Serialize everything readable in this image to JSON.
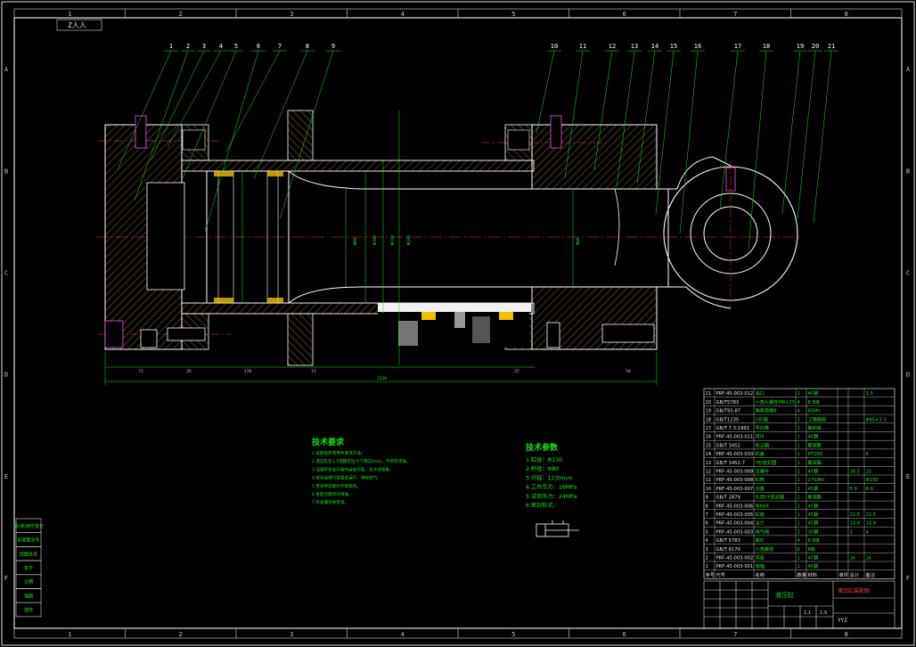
{
  "sheet": {
    "corner_code": "Z人人",
    "title_code": "YYZ",
    "drawing_name": "液压缸",
    "company_name": "液压缸装配图",
    "scale_row": [
      "",
      "",
      "1:1",
      "1:5"
    ]
  },
  "zones": {
    "columns": [
      "1",
      "2",
      "3",
      "4",
      "5",
      "6",
      "7",
      "8"
    ],
    "rows": [
      "A",
      "B",
      "C",
      "D",
      "E",
      "F"
    ]
  },
  "balloons": [
    "1",
    "2",
    "3",
    "4",
    "5",
    "6",
    "7",
    "8",
    "9",
    "10",
    "11",
    "12",
    "13",
    "14",
    "15",
    "16",
    "17",
    "18",
    "19",
    "20",
    "21"
  ],
  "dimensions": {
    "overall_length": "1230",
    "segments": [
      "72",
      "25",
      "178",
      "15",
      "37",
      "58"
    ],
    "bore_dims": [
      "Φ80",
      "Φ100",
      "Φ110",
      "Φ130"
    ],
    "rod_dim": "Φ60"
  },
  "technical_requirements": {
    "title": "技术要求",
    "lines": [
      "1.装配前所有零件清洗干净。",
      "2.液压缸在1.5倍额定压力下保压5min，不得有渗漏。",
      "3.活塞杆在全行程内运动平稳，无卡滞现象。",
      "4.安装后进行空载试运行，排除空气。",
      "5.密封件装配时不得损伤。",
      "6.各配合面涂润滑油。",
      "7.外表面涂防锈漆。"
    ]
  },
  "technical_parameters": {
    "title": "技术参数",
    "lines": [
      "1.缸径：Φ130",
      "2.杆径：Φ80",
      "3.行程：1230mm",
      "4.工作压力：16MPa",
      "5.试验压力：24MPa",
      "6.密封形式："
    ]
  },
  "parts_list": {
    "headers": [
      "序号",
      "代号",
      "名称",
      "数量",
      "材料",
      "单件",
      "总计",
      "备注"
    ],
    "rows": [
      [
        "21",
        "PRF-45-003-012",
        "油口",
        "1",
        "45钢",
        "",
        "",
        "1.5"
      ],
      [
        "20",
        "GB/T5783",
        "六角头螺栓M8×25",
        "4",
        "8.8级",
        "",
        "",
        ""
      ],
      [
        "19",
        "GB/T93-87",
        "弹簧垫圈8",
        "4",
        "65Mn",
        "",
        "",
        ""
      ],
      [
        "18",
        "GB/T1235",
        "O形圈",
        "2",
        "丁腈橡胶",
        "",
        "",
        "Φ85×3.1"
      ],
      [
        "17",
        "GB/T 7.3-1993",
        "导向带",
        "1",
        "聚四氟",
        "",
        "",
        ""
      ],
      [
        "16",
        "PRF-45-003-011",
        "耳环",
        "1",
        "45钢",
        "",
        "",
        ""
      ],
      [
        "15",
        "GB/T 3452",
        "防尘圈",
        "1",
        "聚氨酯",
        "",
        "",
        ""
      ],
      [
        "14",
        "PRF-45-003-010",
        "缸盖",
        "1",
        "HT200",
        "",
        "",
        "6"
      ],
      [
        "13",
        "GB/T 3452-7",
        "Y形密封圈",
        "1",
        "聚氨酯",
        "",
        "",
        ""
      ],
      [
        "12",
        "PRF-45-003-009",
        "活塞杆",
        "1",
        "45钢",
        "",
        "16.5",
        "15"
      ],
      [
        "11",
        "PRF-45-003-008",
        "缸筒",
        "1",
        "27SiMn",
        "",
        "",
        "Φ130"
      ],
      [
        "10",
        "PRF-45-003-007",
        "活塞",
        "1",
        "45钢",
        "",
        "8.9",
        "8.9"
      ],
      [
        "9",
        "GB/T 2879",
        "孔用YX密封圈",
        "2",
        "聚氨酯",
        "",
        "",
        ""
      ],
      [
        "8",
        "PRF-45-003-006",
        "导向环",
        "1",
        "45钢",
        "",
        "",
        ""
      ],
      [
        "7",
        "PRF-45-003-005",
        "缸底",
        "1",
        "45钢",
        "",
        "22.5",
        "22.5"
      ],
      [
        "6",
        "PRF-45-003-004",
        "法兰",
        "1",
        "45钢",
        "",
        "14.8",
        "14.8"
      ],
      [
        "5",
        "PRF-45-003-003",
        "排气阀",
        "2",
        "35钢",
        "",
        "3",
        "4"
      ],
      [
        "4",
        "GB/T 5783",
        "螺钉",
        "4",
        "8.8级",
        "",
        "",
        ""
      ],
      [
        "3",
        "GB/T 6170",
        "六角螺母",
        "6",
        "8级",
        "",
        "",
        ""
      ],
      [
        "2",
        "PRF-45-003-002",
        "耳座",
        "1",
        "45钢",
        "",
        "16",
        "16"
      ],
      [
        "1",
        "PRF-45-003-001",
        "销轴",
        "1",
        "45钢",
        "",
        "",
        ""
      ]
    ]
  },
  "side_table": {
    "labels": [
      "借(通)用件登记",
      "旧底图总号",
      "底图总号",
      "签字",
      "日期",
      "描图",
      "描校"
    ]
  },
  "colors": {
    "background": "#000000",
    "outline": "#ffffff",
    "dimension": "#19e619",
    "centerline": "#ff3030",
    "hatch": "#c89650",
    "yellow": "#f0c000",
    "border": "#dcdcdc"
  }
}
